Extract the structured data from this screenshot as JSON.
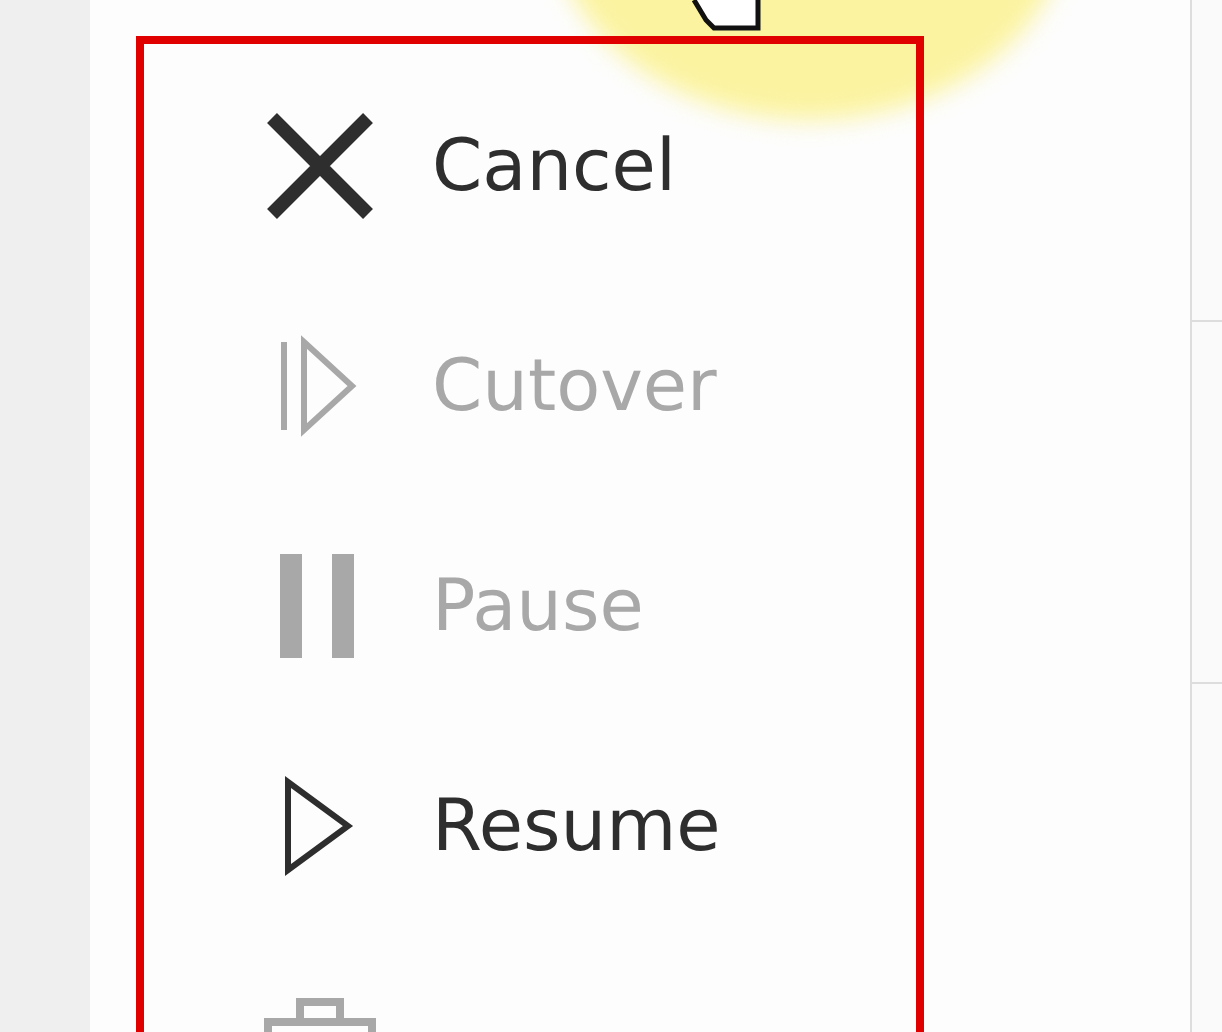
{
  "menu": {
    "items": [
      {
        "kind": "cancel",
        "label": "Cancel",
        "disabled": false
      },
      {
        "kind": "cutover",
        "label": "Cutover",
        "disabled": true
      },
      {
        "kind": "pause",
        "label": "Pause",
        "disabled": true
      },
      {
        "kind": "resume",
        "label": "Resume",
        "disabled": false
      },
      {
        "kind": "briefcase",
        "disabled": true
      }
    ]
  }
}
